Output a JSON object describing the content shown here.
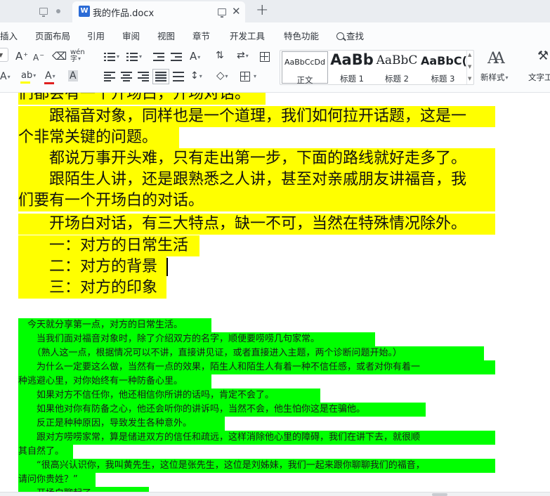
{
  "tabs": {
    "active_title": "我的作品.docx",
    "doc_icon_letter": "W",
    "close_glyph": "✕",
    "new_tab_glyph": "+"
  },
  "menu": {
    "items": [
      "插入",
      "页面布局",
      "引用",
      "审阅",
      "视图",
      "章节",
      "开发工具",
      "特色功能"
    ],
    "search_label": "查找"
  },
  "ribbon": {
    "grow_font": "A",
    "shrink_font": "A",
    "pinyin": "wén",
    "styles": [
      {
        "sample": "AaBbCcDd",
        "label": "正文"
      },
      {
        "sample": "AaBb",
        "label": "标题 1"
      },
      {
        "sample": "AaBbC",
        "label": "标题 2"
      },
      {
        "sample": "AaBbC(",
        "label": "标题 3"
      }
    ],
    "new_style_label": "新样式",
    "text_tools_label": "文字工",
    "highlight_color": "#ffff00",
    "font_color": "#e02020"
  },
  "document": {
    "yellow_lines": [
      "们都会有一个开场白，开场对话。",
      "　　跟福音对象，同样也是一个道理，我们如何拉开话题，这是一",
      "个非常关键的问题。",
      "　　都说万事开头难，只有走出第一步，下面的路线就好走多了。",
      "　　跟陌生人讲，还是跟熟悉之人讲，甚至对亲戚朋友讲福音，我",
      "们要有一个开场白的对话。",
      "　　开场白对话，有三大特点，缺一不可，当然在特殊情况除外。",
      "　　一：对方的日常生活",
      "　　二：对方的背景",
      "　　三：对方的印象"
    ],
    "green_lines": [
      "　今天就分享第一点，对方的日常生活。",
      "　　当我们面对福音对象时，除了介绍双方的名字，顺便要唠唠几句家常。",
      "　　（熟人这一点，根据情况可以不讲，直接讲见证，或者直接进入主题，两个诊断问题开始。）",
      "　　为什么一定要这么做，当然有一点的效果，陌生人和陌生人有着一种不信任感，或者对你有着一",
      "种逃避心里，对你始终有一种防备心里。",
      "　　如果对方不信任你，他还相信你所讲的话吗，肯定不会了。",
      "　　如果他对你有防备之心，他还会听你的讲诉吗，当然不会，他生怕你这是在骗他。",
      "　　反正是种种原因，导致发生各种意外。",
      "　　跟对方唠唠家常，算是储进双方的信任和疏远，这样消除他心里的障碍，我们在讲下去，就很顺",
      "其自然了。",
      "　　“很高兴认识你，我叫黄先生，这位是张先生，这位是刘姊妹，我们一起来跟你聊聊我们的福音，",
      "请问你贵姓？”",
      "　　开场白聊起了。"
    ]
  }
}
